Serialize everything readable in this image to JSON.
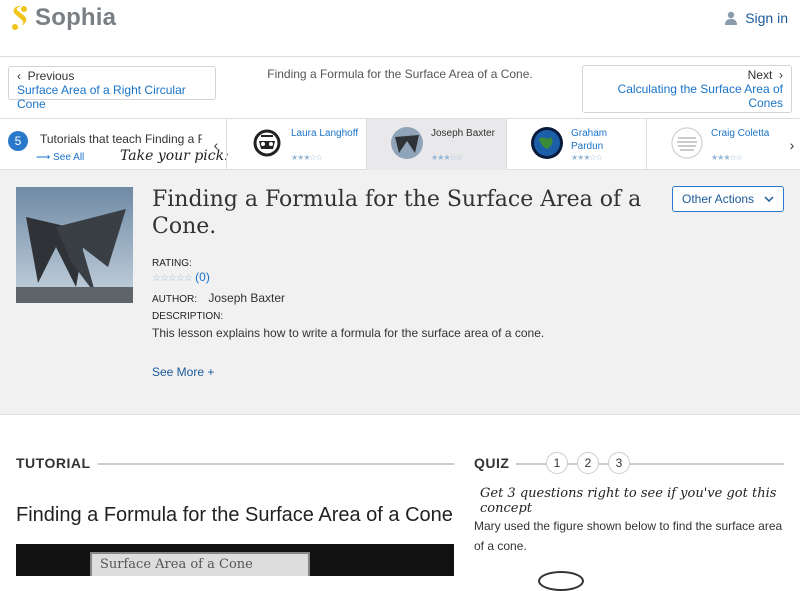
{
  "brand": {
    "name": "Sophia",
    "color": "#f0c419"
  },
  "header": {
    "signin_label": "Sign in"
  },
  "nav": {
    "prev_label": "Previous",
    "prev_link": "Surface Area of a Right Circular Cone",
    "center_title": "Finding a Formula for the Surface Area of a Cone.",
    "next_label": "Next",
    "next_link": "Calculating the Surface Area of Cones"
  },
  "tutorials_bar": {
    "count": "5",
    "teach_label": "Tutorials that teach Finding a F",
    "see_all": "See All",
    "pick": "Take your pick:",
    "cards": [
      {
        "name": "Laura Langhoff",
        "stars": "★★★☆☆"
      },
      {
        "name": "Joseph Baxter",
        "stars": "★★★☆☆"
      },
      {
        "name": "Graham Pardun",
        "stars": "★★★☆☆"
      },
      {
        "name": "Craig Coletta",
        "stars": "★★★☆☆"
      }
    ]
  },
  "lesson": {
    "title": "Finding a Formula for the Surface Area of a Cone.",
    "rating_label": "RATING:",
    "rating_stars": "☆☆☆☆☆",
    "rating_count": "(0)",
    "author_label": "AUTHOR:",
    "author": "Joseph Baxter",
    "description_label": "DESCRIPTION:",
    "description": "This lesson explains how to write a formula for the surface area of a cone.",
    "see_more": "See More +",
    "other_actions": "Other Actions"
  },
  "tutorial": {
    "heading": "TUTORIAL",
    "title": "Finding a Formula for the Surface Area of a Cone",
    "video_caption": "Surface Area of a Cone"
  },
  "quiz": {
    "heading": "QUIZ",
    "steps": [
      "1",
      "2",
      "3"
    ],
    "tagline": "Get 3 questions right to see if you've got this concept",
    "question": "Mary used the figure shown below to find the surface area of a cone."
  }
}
